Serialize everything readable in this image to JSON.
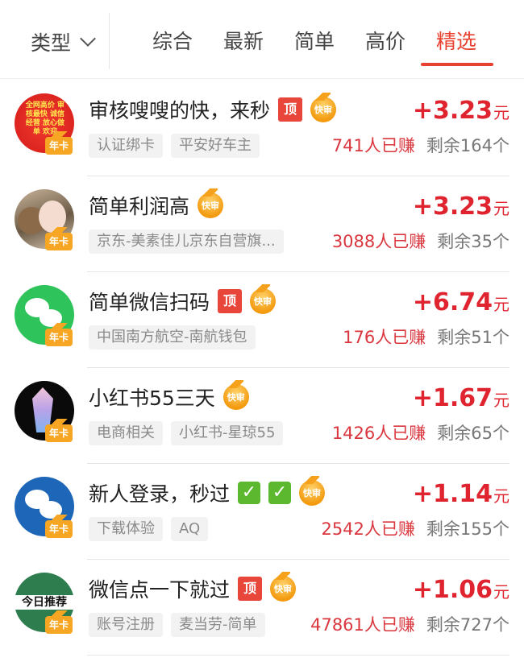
{
  "filter": {
    "type_label": "类型",
    "tabs": [
      {
        "label": "综合"
      },
      {
        "label": "最新"
      },
      {
        "label": "简单"
      },
      {
        "label": "高价"
      },
      {
        "label": "精选"
      }
    ],
    "active_tab": "精选"
  },
  "colors": {
    "accent": "#e8412f",
    "price": "#e0242f",
    "chip_bg": "#f2f2f2",
    "year_badge": "#f6a623"
  },
  "badges": {
    "top": "顶",
    "fast": "快审",
    "year": "年卡"
  },
  "avatar_texts": {
    "item1": "全网高价 审核最快 诚信经营 放心做单 欢迎",
    "item6": "今日推荐"
  },
  "items": [
    {
      "title": "审核嗖嗖的快，来秒",
      "has_top": true,
      "has_fast": true,
      "reward_sign": "+",
      "reward": "3.23",
      "unit": "元",
      "tags": [
        "认证绑卡",
        "平安好车主"
      ],
      "earned_count": "741",
      "earned_suffix": "人已赚",
      "remain": "剩余164个",
      "avatar_icon": "promo-avatar-icon"
    },
    {
      "title": "简单利润高",
      "has_top": false,
      "has_fast": true,
      "reward_sign": "+",
      "reward": "3.23",
      "unit": "元",
      "tags": [
        "京东-美素佳儿京东自营旗..."
      ],
      "earned_count": "3088",
      "earned_suffix": "人已赚",
      "remain": "剩余35个",
      "avatar_icon": "girl-photo-avatar-icon"
    },
    {
      "title": "简单微信扫码",
      "has_top": true,
      "has_fast": true,
      "reward_sign": "+",
      "reward": "6.74",
      "unit": "元",
      "tags": [
        "中国南方航空-南航钱包"
      ],
      "earned_count": "176",
      "earned_suffix": "人已赚",
      "remain": "剩余51个",
      "avatar_icon": "wechat-icon"
    },
    {
      "title": "小红书55三天",
      "has_top": false,
      "has_fast": true,
      "reward_sign": "+",
      "reward": "1.67",
      "unit": "元",
      "tags": [
        "电商相关",
        "小红书-星琼55"
      ],
      "earned_count": "1426",
      "earned_suffix": "人已赚",
      "remain": "剩余65个",
      "avatar_icon": "crystal-avatar-icon"
    },
    {
      "title": "新人登录，秒过",
      "has_checks": true,
      "has_top": false,
      "has_fast": true,
      "reward_sign": "+",
      "reward": "1.14",
      "unit": "元",
      "tags": [
        "下载体验",
        "AQ"
      ],
      "earned_count": "2542",
      "earned_suffix": "人已赚",
      "remain": "剩余155个",
      "avatar_icon": "wechat-blue-icon"
    },
    {
      "title": "微信点一下就过",
      "has_top": true,
      "has_fast": true,
      "reward_sign": "+",
      "reward": "1.06",
      "unit": "元",
      "tags": [
        "账号注册",
        "麦当劳-简单"
      ],
      "earned_count": "47861",
      "earned_suffix": "人已赚",
      "remain": "剩余727个",
      "avatar_icon": "daily-pick-avatar-icon"
    }
  ]
}
